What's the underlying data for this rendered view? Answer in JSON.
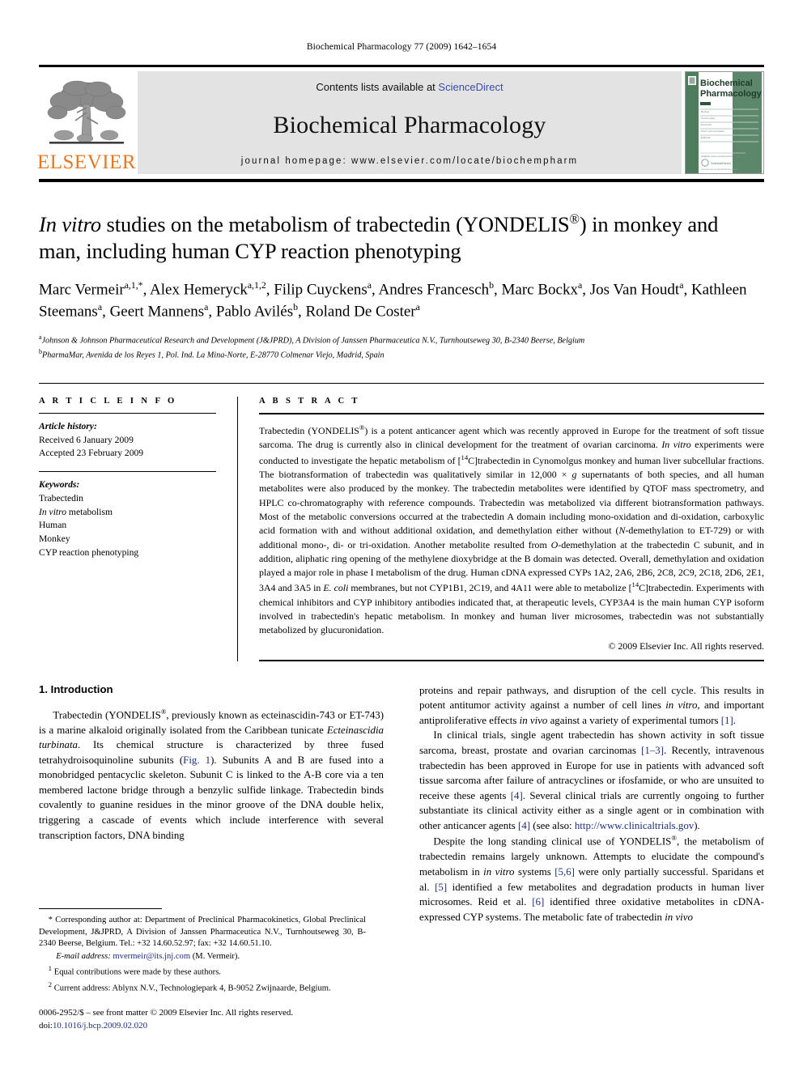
{
  "running_head": "Biochemical Pharmacology 77 (2009) 1642–1654",
  "masthead": {
    "publisher_wordmark": "ELSEVIER",
    "contents_prefix": "Contents lists available at ",
    "contents_link": "ScienceDirect",
    "journal_title": "Biochemical Pharmacology",
    "homepage": "journal homepage: www.elsevier.com/locate/biochempharm",
    "cover_title_line1": "Biochemical",
    "cover_title_line2": "Pharmacology"
  },
  "title": {
    "part1_italic": "In vitro",
    "part2": " studies on the metabolism of trabectedin (YONDELIS",
    "reg": "®",
    "part3": ") in monkey and man, including human CYP reaction phenotyping"
  },
  "authors": [
    {
      "name": "Marc Vermeir",
      "sup": "a,1,*",
      "sep": ", "
    },
    {
      "name": "Alex Hemeryck",
      "sup": "a,1,2",
      "sep": ", "
    },
    {
      "name": "Filip Cuyckens",
      "sup": "a",
      "sep": ", "
    },
    {
      "name": "Andres Francesch",
      "sup": "b",
      "sep": ", "
    },
    {
      "name": "Marc Bockx",
      "sup": "a",
      "sep": ", "
    },
    {
      "name": "Jos Van Houdt",
      "sup": "a",
      "sep": ", "
    },
    {
      "name": "Kathleen Steemans",
      "sup": "a",
      "sep": ", "
    },
    {
      "name": "Geert Mannens",
      "sup": "a",
      "sep": ", "
    },
    {
      "name": "Pablo Avilés",
      "sup": "b",
      "sep": ", "
    },
    {
      "name": "Roland De Coster",
      "sup": "a",
      "sep": ""
    }
  ],
  "affiliations": [
    {
      "marker": "a",
      "text": "Johnson & Johnson Pharmaceutical Research and Development (J&JPRD), A Division of Janssen Pharmaceutica N.V., Turnhoutseweg 30, B-2340 Beerse, Belgium"
    },
    {
      "marker": "b",
      "text": "PharmaMar, Avenida de los Reyes 1, Pol. Ind. La Mina-Norte, E-28770 Colmenar Viejo, Madrid, Spain"
    }
  ],
  "article_info": {
    "label": "A R T I C L E    I N F O",
    "history_head": "Article history:",
    "history": [
      "Received 6 January 2009",
      "Accepted 23 February 2009"
    ],
    "keywords_head": "Keywords:",
    "keywords": [
      "Trabectedin",
      "In vitro metabolism",
      "Human",
      "Monkey",
      "CYP reaction phenotyping"
    ]
  },
  "abstract": {
    "label": "A B S T R A C T",
    "text_segments": [
      {
        "t": "Trabectedin (YONDELIS"
      },
      {
        "t": "®",
        "sup": true
      },
      {
        "t": ") is a potent anticancer agent which was recently approved in Europe for the treatment of soft tissue sarcoma. The drug is currently also in clinical development for the treatment of ovarian carcinoma. "
      },
      {
        "t": "In vitro",
        "ital": true
      },
      {
        "t": " experiments were conducted to investigate the hepatic metabolism of ["
      },
      {
        "t": "14",
        "sup": true
      },
      {
        "t": "C]trabectedin in Cynomolgus monkey and human liver subcellular fractions. The biotransformation of trabectedin was qualitatively similar in 12,000 × "
      },
      {
        "t": "g",
        "ital": true
      },
      {
        "t": " supernatants of both species, and all human metabolites were also produced by the monkey. The trabectedin metabolites were identified by QTOF mass spectrometry, and HPLC co-chromatography with reference compounds. Trabectedin was metabolized via different biotransformation pathways. Most of the metabolic conversions occurred at the trabectedin A domain including mono-oxidation and di-oxidation, carboxylic acid formation with and without additional oxidation, and demethylation either without ("
      },
      {
        "t": "N",
        "ital": true
      },
      {
        "t": "-demethylation to ET-729) or with additional mono-, di- or tri-oxidation. Another metabolite resulted from "
      },
      {
        "t": "O",
        "ital": true
      },
      {
        "t": "-demethylation at the trabectedin C subunit, and in addition, aliphatic ring opening of the methylene dioxybridge at the B domain was detected. Overall, demethylation and oxidation played a major role in phase I metabolism of the drug. Human cDNA expressed CYPs 1A2, 2A6, 2B6, 2C8, 2C9, 2C18, 2D6, 2E1, 3A4 and 3A5 in "
      },
      {
        "t": "E. coli",
        "ital": true
      },
      {
        "t": " membranes, but not CYP1B1, 2C19, and 4A11 were able to metabolize ["
      },
      {
        "t": "14",
        "sup": true
      },
      {
        "t": "C]trabectedin. Experiments with chemical inhibitors and CYP inhibitory antibodies indicated that, at therapeutic levels, CYP3A4 is the main human CYP isoform involved in trabectedin's hepatic metabolism. In monkey and human liver microsomes, trabectedin was not substantially metabolized by glucuronidation."
      }
    ],
    "copyright": "© 2009 Elsevier Inc. All rights reserved."
  },
  "introduction": {
    "heading": "1.  Introduction",
    "left_paragraphs": [
      {
        "segments": [
          {
            "t": "Trabectedin (YONDELIS"
          },
          {
            "t": "®",
            "sup": true
          },
          {
            "t": ", previously known as ecteinascidin-743 or ET-743) is a marine alkaloid originally isolated from the Caribbean tunicate "
          },
          {
            "t": "Ecteinascidia turbinata",
            "ital": true
          },
          {
            "t": ". Its chemical structure is characterized by three fused tetrahydroisoquinoline subunits ("
          },
          {
            "t": "Fig. 1",
            "ref": true
          },
          {
            "t": "). Subunits A and B are fused into a monobridged pentacyclic skeleton. Subunit C is linked to the A-B core via a ten membered lactone bridge through a benzylic sulfide linkage. Trabectedin binds covalently to guanine residues in the minor groove of the DNA double helix, triggering a cascade of events which include interference with several transcription factors, DNA binding"
          }
        ]
      }
    ],
    "right_paragraphs": [
      {
        "noindent": true,
        "segments": [
          {
            "t": "proteins and repair pathways, and disruption of the cell cycle. This results in potent antitumor activity against a number of cell lines "
          },
          {
            "t": "in vitro",
            "ital": true
          },
          {
            "t": ", and important antiproliferative effects "
          },
          {
            "t": "in vivo",
            "ital": true
          },
          {
            "t": " against a variety of experimental tumors "
          },
          {
            "t": "[1]",
            "ref": true
          },
          {
            "t": "."
          }
        ]
      },
      {
        "segments": [
          {
            "t": "In clinical trials, single agent trabectedin has shown activity in soft tissue sarcoma, breast, prostate and ovarian carcinomas "
          },
          {
            "t": "[1–3]",
            "ref": true
          },
          {
            "t": ". Recently, intravenous trabectedin has been approved in Europe for use in patients with advanced soft tissue sarcoma after failure of antracyclines or ifosfamide, or who are unsuited to receive these agents "
          },
          {
            "t": "[4]",
            "ref": true
          },
          {
            "t": ". Several clinical trials are currently ongoing to further substantiate its clinical activity either as a single agent or in combination with other anticancer agents "
          },
          {
            "t": "[4]",
            "ref": true
          },
          {
            "t": " (see also: "
          },
          {
            "t": "http://www.clinicaltrials.gov",
            "ref": true
          },
          {
            "t": ")."
          }
        ]
      },
      {
        "segments": [
          {
            "t": "Despite the long standing clinical use of YONDELIS"
          },
          {
            "t": "®",
            "sup": true
          },
          {
            "t": ", the metabolism of trabectedin remains largely unknown. Attempts to elucidate the compound's metabolism in "
          },
          {
            "t": "in vitro",
            "ital": true
          },
          {
            "t": " systems "
          },
          {
            "t": "[5,6]",
            "ref": true
          },
          {
            "t": " were only partially successful. Sparidans et al. "
          },
          {
            "t": "[5]",
            "ref": true
          },
          {
            "t": " identified a few metabolites and degradation products in human liver microsomes. Reid et al. "
          },
          {
            "t": "[6]",
            "ref": true
          },
          {
            "t": " identified three oxidative metabolites in cDNA-expressed CYP systems. The metabolic fate of trabectedin "
          },
          {
            "t": "in vivo",
            "ital": true
          }
        ]
      }
    ]
  },
  "footnotes": {
    "corresponding": "* Corresponding author at: Department of Preclinical Pharmacokinetics, Global Preclinical Development, J&JPRD, A Division of Janssen Pharmaceutica N.V., Turnhoutseweg 30, B-2340 Beerse, Belgium. Tel.: +32 14.60.52.97; fax: +32 14.60.51.10.",
    "email_label": "E-mail address:",
    "email": "mvermeir@its.jnj.com",
    "email_suffix": "(M. Vermeir).",
    "note1_marker": "1",
    "note1": "Equal contributions were made by these authors.",
    "note2_marker": "2",
    "note2": "Current address: Ablynx N.V., Technologiepark 4, B-9052 Zwijnaarde, Belgium.",
    "imprint_line1": "0006-2952/$ – see front matter © 2009 Elsevier Inc. All rights reserved.",
    "imprint_doi_label": "doi:",
    "imprint_doi": "10.1016/j.bcp.2009.02.020"
  },
  "colors": {
    "elsevier_orange": "#E87722",
    "link_blue": "#3b4ba8",
    "ref_blue": "#1e2f7a",
    "banner_grey": "#e3e3e3",
    "cover_green": "#4e7d5e"
  }
}
